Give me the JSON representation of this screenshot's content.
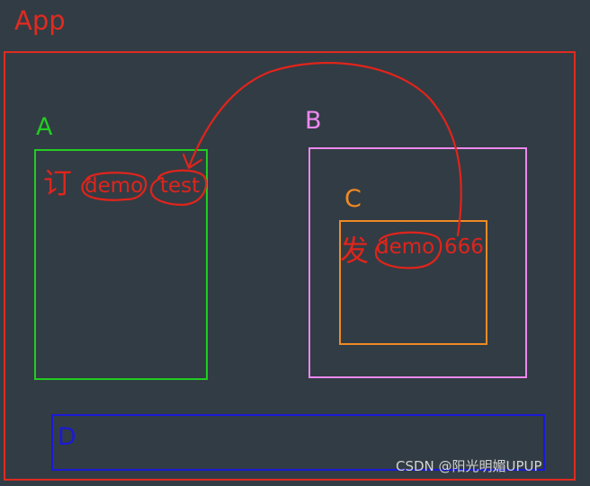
{
  "diagram": {
    "app": {
      "label": "App",
      "color": "#e02b20"
    },
    "component_a": {
      "label": "A",
      "color": "#22cc22",
      "note": {
        "verb": "订",
        "topic": "demo",
        "value": "test"
      }
    },
    "component_b": {
      "label": "B",
      "color": "#ee88ee"
    },
    "component_c": {
      "label": "C",
      "color": "#f08a24",
      "note": {
        "verb": "发",
        "topic": "demo",
        "value": "666"
      }
    },
    "component_d": {
      "label": "D",
      "color": "#1a1ad6"
    },
    "annotation_color": "#e0241b"
  },
  "watermark": {
    "text": "CSDN @阳光明媚UPUP"
  }
}
